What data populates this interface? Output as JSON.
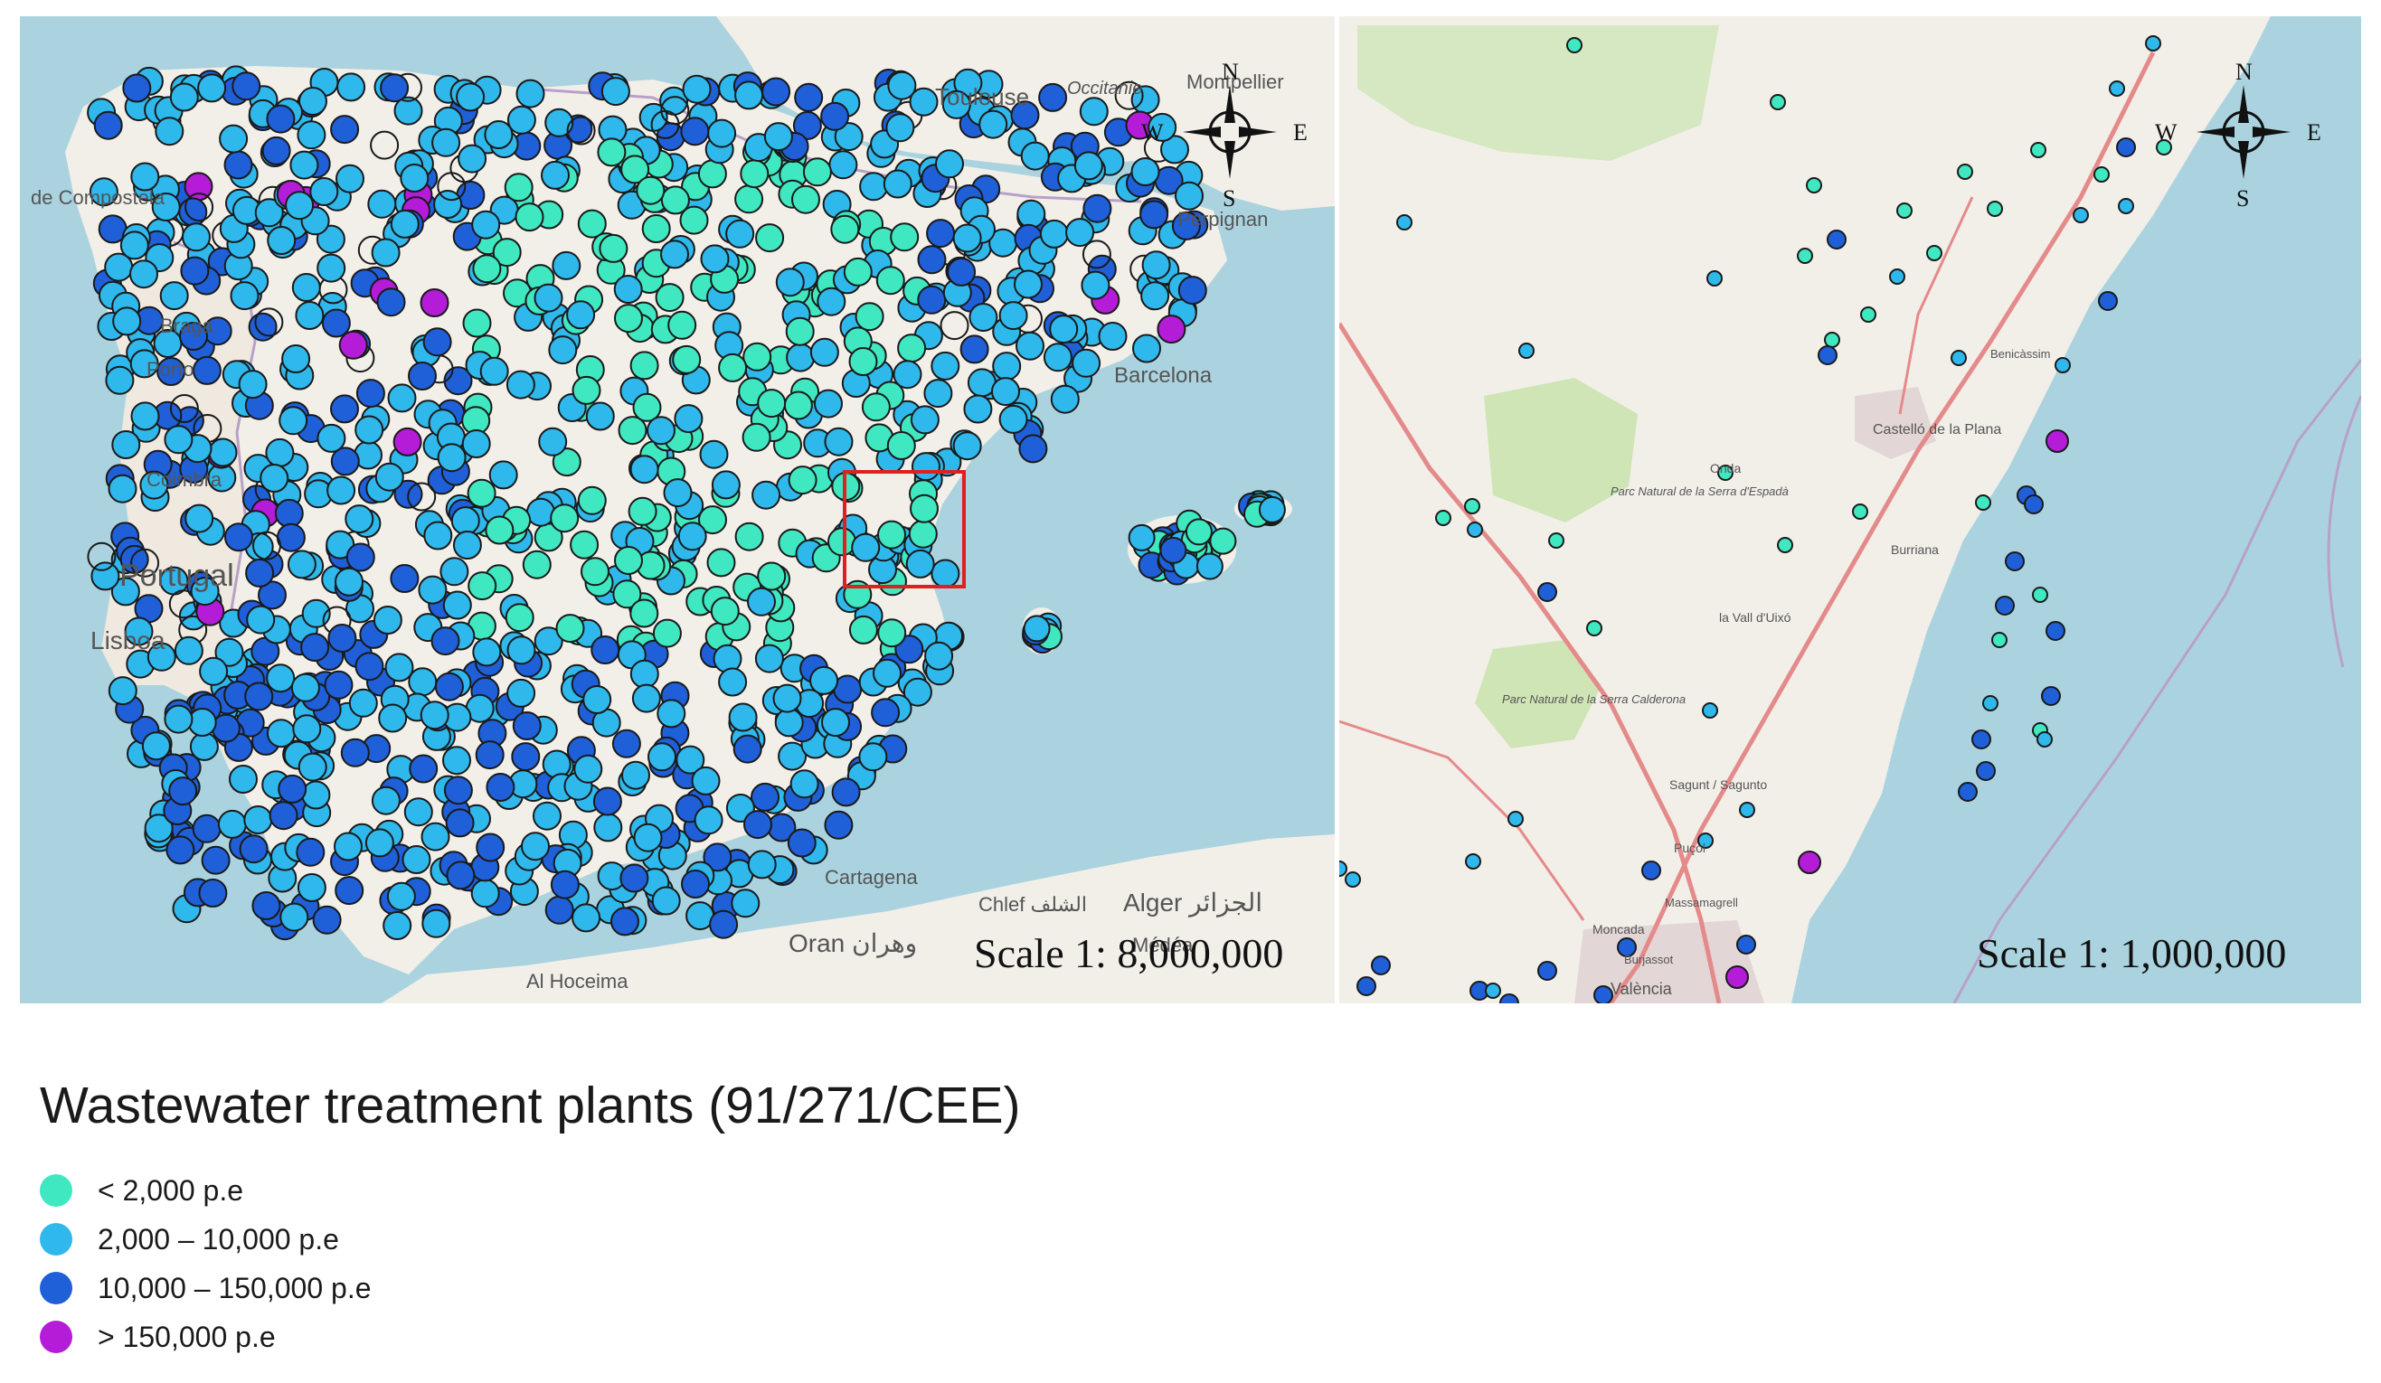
{
  "left_map": {
    "scale": "Scale 1: 8,000,000",
    "compass": {
      "n": "N",
      "s": "S",
      "e": "E",
      "w": "W"
    },
    "places": [
      {
        "name": "Toulouse",
        "sub": false
      },
      {
        "name": "Occitanie",
        "sub": true
      },
      {
        "name": "Montpellier",
        "sub": false
      },
      {
        "name": "Perpignan",
        "sub": false
      },
      {
        "name": "de Compostela",
        "sub": false
      },
      {
        "name": "Braga",
        "sub": false
      },
      {
        "name": "Porto",
        "sub": false
      },
      {
        "name": "Coimbra",
        "sub": false
      },
      {
        "name": "Portugal",
        "sub": false
      },
      {
        "name": "Lisboa",
        "sub": false
      },
      {
        "name": "Oran وهران",
        "sub": false
      },
      {
        "name": "Al Hoceima",
        "sub": false
      },
      {
        "name": "Chlef الشلف",
        "sub": false
      },
      {
        "name": "Alger الجزائر",
        "sub": false
      },
      {
        "name": "Médéa",
        "sub": false
      },
      {
        "name": "Cartagena",
        "sub": false
      },
      {
        "name": "Barcelona",
        "sub": false
      }
    ],
    "zoom_box_color": "#e02020"
  },
  "right_map": {
    "scale": "Scale 1: 1,000,000",
    "compass": {
      "n": "N",
      "s": "S",
      "e": "E",
      "w": "W"
    },
    "places": [
      {
        "name": "Castelló de la Plana",
        "sub": false
      },
      {
        "name": "Parc Natural de la Serra d'Espadà",
        "sub": true
      },
      {
        "name": "Parc Natural de la Serra Calderona",
        "sub": true
      },
      {
        "name": "Onda",
        "sub": false
      },
      {
        "name": "Burriana",
        "sub": false
      },
      {
        "name": "la Vall d'Uixó",
        "sub": false
      },
      {
        "name": "Sagunt / Sagunto",
        "sub": false
      },
      {
        "name": "Puçol",
        "sub": false
      },
      {
        "name": "Massamagrell",
        "sub": false
      },
      {
        "name": "Moncada",
        "sub": false
      },
      {
        "name": "Burjassot",
        "sub": false
      },
      {
        "name": "València",
        "sub": false
      },
      {
        "name": "Benicàssim",
        "sub": false
      }
    ]
  },
  "legend": {
    "title": "Wastewater treatment plants (91/271/CEE)",
    "items": [
      {
        "label": "< 2,000 p.e",
        "color": "#3fe8c0"
      },
      {
        "label": "2,000 – 10,000 p.e",
        "color": "#2fb8ec"
      },
      {
        "label": "10,000 – 150,000 p.e",
        "color": "#1f5fd8"
      },
      {
        "label": "> 150,000 p.e",
        "color": "#b41cd8"
      }
    ]
  },
  "colors": {
    "sea": "#abd3df",
    "land": "#f2efe9",
    "park": "#cfe5b5",
    "road": "#e58a8a",
    "border": "#b8a0c8"
  }
}
